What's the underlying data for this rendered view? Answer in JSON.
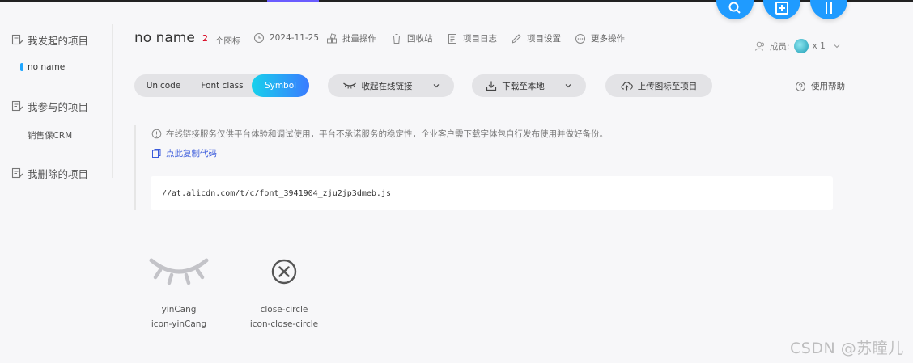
{
  "sidebar": {
    "my_projects": "我发起的项目",
    "active_project": "no name",
    "joined_projects": "我参与的项目",
    "joined_item": "销售保CRM",
    "deleted_projects": "我删除的项目"
  },
  "header": {
    "title": "no name",
    "icon_count": "2",
    "icon_unit": "个图标",
    "date": "2024-11-25",
    "batch": "批量操作",
    "recycle": "回收站",
    "log": "项目日志",
    "settings": "项目设置",
    "more": "更多操作",
    "members_label": "成员:",
    "members_count": "x 1"
  },
  "toolbar": {
    "tab_unicode": "Unicode",
    "tab_fontclass": "Font class",
    "tab_symbol": "Symbol",
    "active_tab": "Symbol",
    "online_link": "收起在线链接",
    "download": "下载至本地",
    "upload": "上传图标至项目",
    "help": "使用帮助"
  },
  "panel": {
    "notice": "在线链接服务仅供平台体验和调试使用，平台不承诺服务的稳定性，企业客户需下载字体包自行发布使用并做好备份。",
    "copy_code": "点此复制代码",
    "code": "//at.alicdn.com/t/c/font_3941904_zju2jp3dmeb.js"
  },
  "icons": [
    {
      "name": "yinCang",
      "code": "icon-yinCang",
      "icon": "closed-eye-icon"
    },
    {
      "name": "close-circle",
      "code": "icon-close-circle",
      "icon": "close-circle-icon"
    }
  ],
  "watermark": "CSDN @苏瞳儿",
  "colors": {
    "accent_gradient_start": "#18d1ec",
    "accent_gradient_end": "#3a7bff",
    "count_red": "#d9001b",
    "link_blue": "#3b5bdb",
    "floating_button": "#1f9bff"
  }
}
